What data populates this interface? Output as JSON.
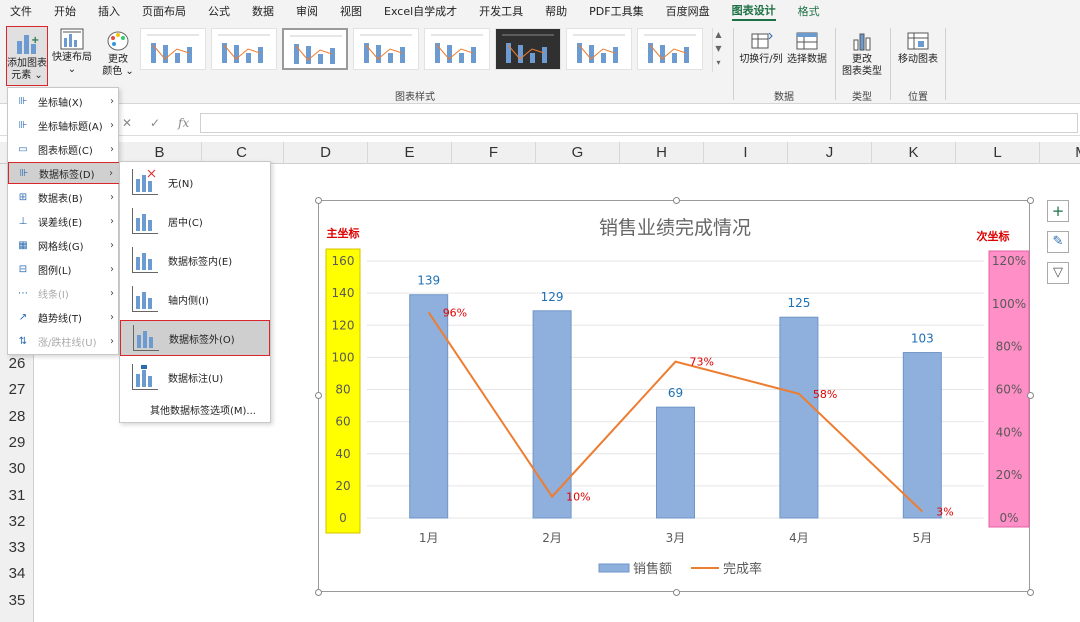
{
  "tabs": [
    "文件",
    "开始",
    "插入",
    "页面布局",
    "公式",
    "数据",
    "审阅",
    "视图",
    "Excel自学成才",
    "开发工具",
    "帮助",
    "PDF工具集",
    "百度网盘",
    "图表设计",
    "格式"
  ],
  "ribbon": {
    "add_element": "添加图表\n元素",
    "add_element_l1": "添加图表",
    "add_element_l2": "元素 ⌄",
    "quick_layout_l1": "快速布局",
    "quick_layout_l2": "⌄",
    "change_color_l1": "更改",
    "change_color_l2": "颜色 ⌄",
    "styles_group": "图表样式",
    "switch_rowcol": "切换行/列",
    "select_data": "选择数据",
    "data_group": "数据",
    "change_type_l1": "更改",
    "change_type_l2": "图表类型",
    "type_group": "类型",
    "move_chart": "移动图表",
    "location_group": "位置"
  },
  "formula_bar": {
    "fx": "fx",
    "cancel": "✕",
    "confirm": "✓"
  },
  "columns": [
    "B",
    "C",
    "D",
    "E",
    "F",
    "G",
    "H",
    "I",
    "J",
    "K",
    "L",
    "M"
  ],
  "rows": [
    "26",
    "27",
    "28",
    "29",
    "30",
    "31",
    "32",
    "33",
    "34",
    "35"
  ],
  "menu": [
    {
      "label": "坐标轴(X)",
      "arrow": true
    },
    {
      "label": "坐标轴标题(A)",
      "arrow": true
    },
    {
      "label": "图表标题(C)",
      "arrow": true
    },
    {
      "label": "数据标签(D)",
      "arrow": true
    },
    {
      "label": "数据表(B)",
      "arrow": true
    },
    {
      "label": "误差线(E)",
      "arrow": true
    },
    {
      "label": "网格线(G)",
      "arrow": true
    },
    {
      "label": "图例(L)",
      "arrow": true
    },
    {
      "label": "线条(I)",
      "arrow": true
    },
    {
      "label": "趋势线(T)",
      "arrow": true
    },
    {
      "label": "涨/跌柱线(U)",
      "arrow": true
    }
  ],
  "submenu": [
    {
      "label": "无(N)"
    },
    {
      "label": "居中(C)"
    },
    {
      "label": "数据标签内(E)"
    },
    {
      "label": "轴内侧(I)"
    },
    {
      "label": "数据标签外(O)"
    },
    {
      "label": "数据标注(U)"
    }
  ],
  "submenu_more": "其他数据标签选项(M)...",
  "chart_data": {
    "type": "bar",
    "title": "销售业绩完成情况",
    "primary_axis_label": "主坐标",
    "secondary_axis_label": "次坐标",
    "categories": [
      "1月",
      "2月",
      "3月",
      "4月",
      "5月"
    ],
    "series": [
      {
        "name": "销售额",
        "type": "bar",
        "values": [
          139,
          129,
          69,
          125,
          103
        ],
        "color": "#8fb0dc"
      },
      {
        "name": "完成率",
        "type": "line",
        "values": [
          96,
          10,
          73,
          58,
          3
        ],
        "labels": [
          "96%",
          "10%",
          "73%",
          "58%",
          "3%"
        ],
        "color": "#ed7d31"
      }
    ],
    "ylim": [
      0,
      160
    ],
    "yticks": [
      "160",
      "140",
      "120",
      "100",
      "80",
      "60",
      "40",
      "20",
      "0"
    ],
    "y2lim": [
      0,
      120
    ],
    "y2ticks": [
      "120%",
      "100%",
      "80%",
      "60%",
      "40%",
      "20%",
      "0%"
    ],
    "colors": {
      "primary_axis_bg": "#ffff00",
      "secondary_axis_bg": "#ff8fc7",
      "axis_label": "#e00000",
      "bar_label": "#1f6fb5",
      "line_label": "#e00000"
    },
    "legend": "bottom",
    "grid": true
  }
}
